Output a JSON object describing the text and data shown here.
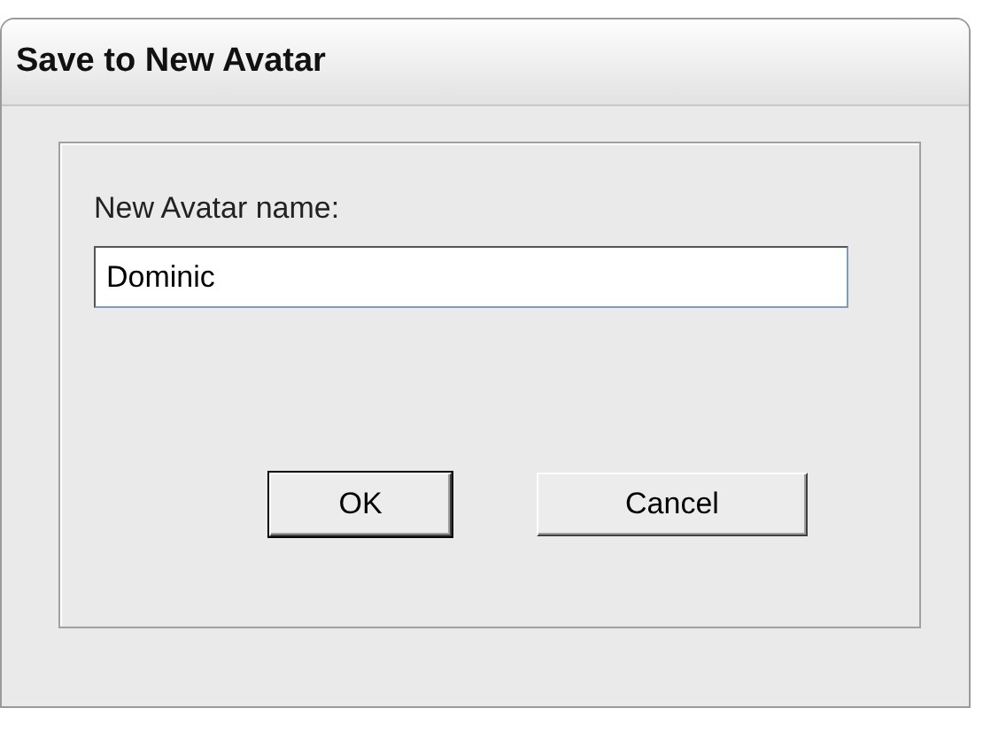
{
  "window": {
    "title": "Save to New Avatar"
  },
  "field": {
    "label": "New Avatar name:",
    "value": "Dominic"
  },
  "buttons": [
    {
      "label": "OK",
      "default": true
    },
    {
      "label": "Cancel",
      "default": false
    }
  ]
}
